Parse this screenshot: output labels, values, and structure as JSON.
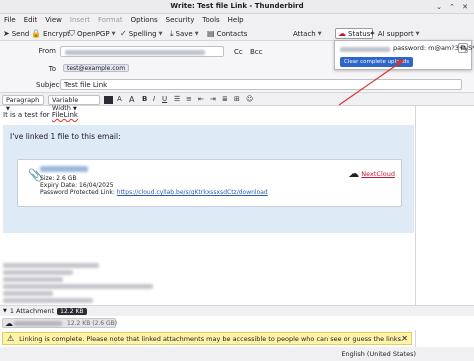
{
  "window": {
    "title": "Write: Test file Link - Thunderbird",
    "controls": [
      "⌄",
      "⌃",
      "✕"
    ]
  },
  "menu": [
    "File",
    "Edit",
    "View",
    "Insert",
    "Format",
    "Options",
    "Security",
    "Tools",
    "Help"
  ],
  "toolbar": {
    "send": "Send",
    "encrypt": "Encrypt",
    "openpgp": "OpenPGP",
    "spelling": "Spelling",
    "save": "Save",
    "contacts": "Contacts",
    "attach": "Attach",
    "status": "Status",
    "ai_support": "AI support"
  },
  "header": {
    "from_label": "From",
    "to_label": "To",
    "subject_label": "Subject",
    "to_value": "test@example.com",
    "subject_value": "Test file Link",
    "cc": "Cc",
    "bcc": "Bcc"
  },
  "format": {
    "paragraph": "Paragraph",
    "font": "Variable Width"
  },
  "body": {
    "line_prefix": "It is a test for ",
    "line_link": "FileLink",
    "lead": "I've linked 1 file to this email:",
    "size": "Size: 2.6 GB",
    "expiry": "Expiry Date: 16/04/2025",
    "pw_link_label": "Password Protected Link: ",
    "pw_link_url": "https://cloud.cyllab.be/s/gKtrkxssxsdCtz/download",
    "provider": "NextCloud"
  },
  "attachments": {
    "label": "1 Attachment",
    "size": "12.2 KB",
    "item_size": "12.2 KB (2.6 GB)"
  },
  "notification": {
    "message": "Linking is complete. Please note that linked attachments may be accessible to people who can see or guess the links."
  },
  "status_bar": {
    "language": "English (United States)"
  },
  "popup": {
    "password": "password: m@am?3+yS*",
    "clear_button": "Clear complete uploads"
  },
  "colors": {
    "accent": "#2f66c9",
    "warning_bg": "#fff3a8",
    "provider_red": "#c0162f",
    "cloud_box": "#dfeaf7"
  }
}
